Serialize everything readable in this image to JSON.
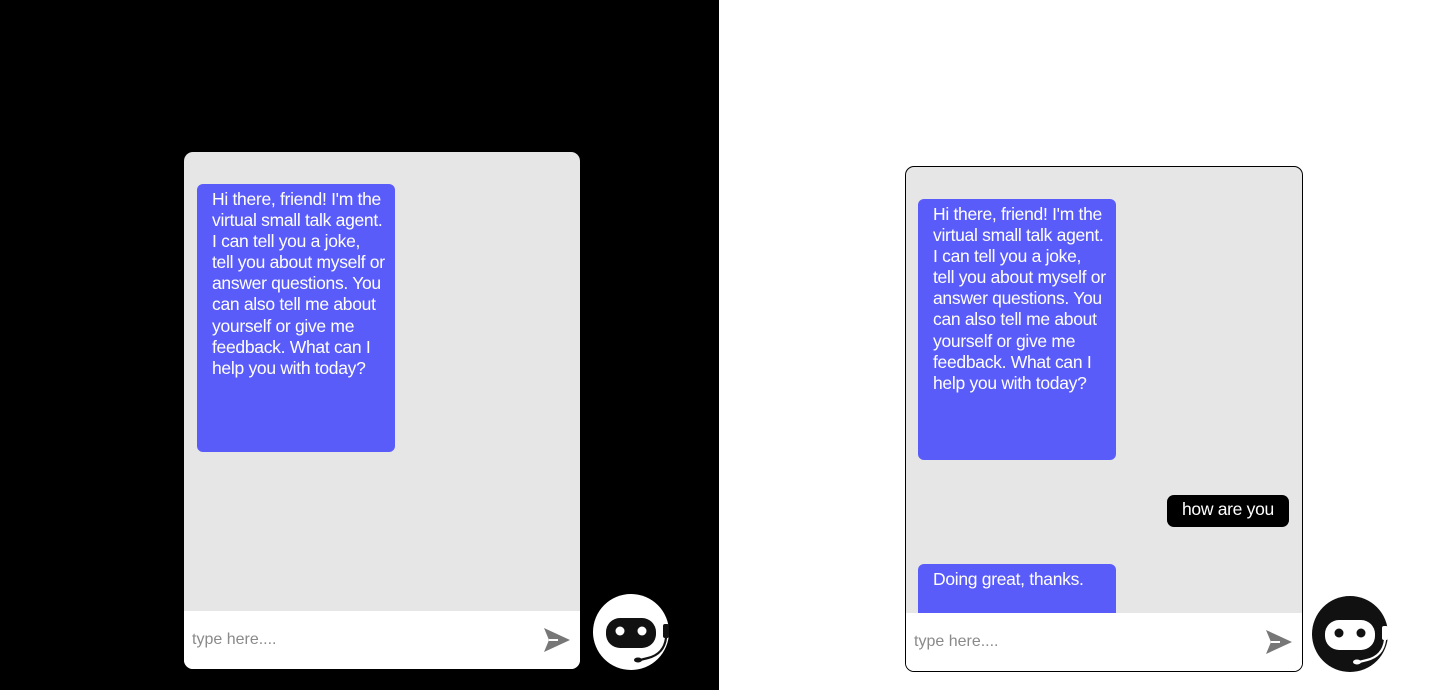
{
  "colors": {
    "left_background": "#000000",
    "right_background": "#ffffff",
    "chat_panel": "#e6e6e6",
    "bot_bubble": "#5a5cfa",
    "user_bubble": "#000000",
    "send_icon": "#777777"
  },
  "left_panel": {
    "messages": [
      {
        "sender": "bot",
        "text": "Hi there, friend! I'm the virtual small talk agent. I can tell you a joke, tell you about myself or answer questions. You can also tell me about yourself or give me feedback. What can I help you with today?"
      }
    ],
    "input": {
      "placeholder": "type here....",
      "value": ""
    },
    "icons": {
      "send": "send-icon",
      "avatar": "robot-headset-icon"
    }
  },
  "right_panel": {
    "messages": [
      {
        "sender": "bot",
        "text": "Hi there, friend! I'm the virtual small talk agent. I can tell you a joke, tell you about myself or answer questions. You can also tell me about yourself or give me feedback. What can I help you with today?"
      },
      {
        "sender": "user",
        "text": "how are you"
      },
      {
        "sender": "bot",
        "text": "Doing great, thanks."
      }
    ],
    "input": {
      "placeholder": "type here....",
      "value": ""
    },
    "icons": {
      "send": "send-icon",
      "avatar": "robot-headset-icon"
    }
  }
}
